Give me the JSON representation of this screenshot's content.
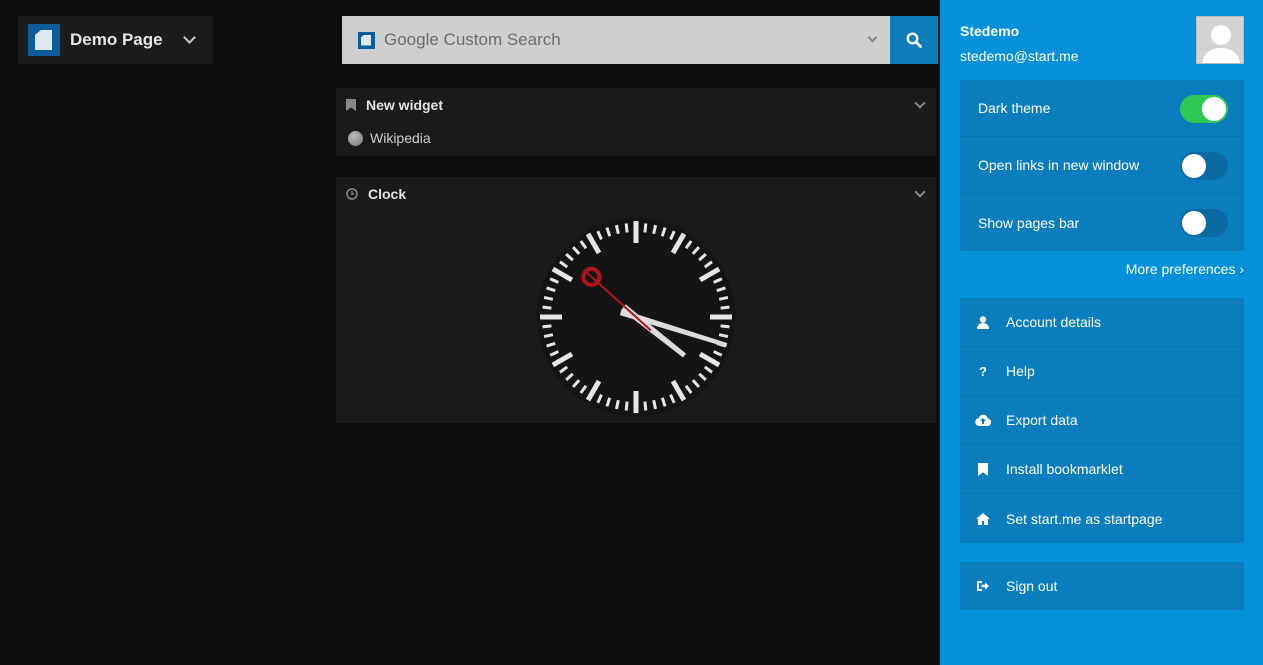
{
  "header": {
    "page_name": "Demo Page",
    "search": {
      "placeholder": "Google Custom Search"
    }
  },
  "widgets": [
    {
      "title": "New widget",
      "links": [
        {
          "label": "Wikipedia",
          "icon": "globe-icon"
        }
      ]
    },
    {
      "title": "Clock",
      "time": "4:17:52"
    }
  ],
  "user": {
    "name": "Stedemo",
    "email": "stedemo@start.me"
  },
  "preferences": [
    {
      "label": "Dark theme",
      "enabled": true
    },
    {
      "label": "Open links in new window",
      "enabled": false
    },
    {
      "label": "Show pages bar",
      "enabled": false
    }
  ],
  "more_preferences": "More preferences ›",
  "menu": [
    {
      "label": "Account details",
      "icon": "user-icon"
    },
    {
      "label": "Help",
      "icon": "question-icon"
    },
    {
      "label": "Export data",
      "icon": "cloud-upload-icon"
    },
    {
      "label": "Install bookmarklet",
      "icon": "bookmark-icon"
    },
    {
      "label": "Set start.me as startpage",
      "icon": "home-icon"
    }
  ],
  "sign_out": "Sign out",
  "colors": {
    "accent": "#0591d8",
    "toggle_on": "#2ec955",
    "second_hand": "#b3121a"
  }
}
